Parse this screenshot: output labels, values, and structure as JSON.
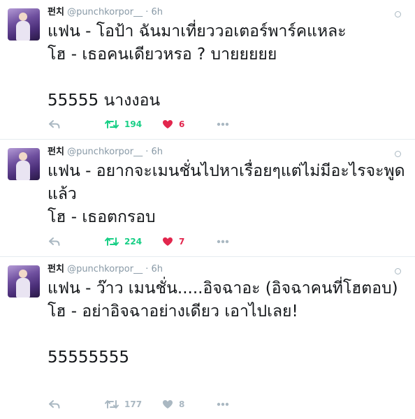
{
  "tweets": [
    {
      "name": "펀치",
      "handle": "@punchkorpor__",
      "sep": "·",
      "time": "6h",
      "text": "แฟน - โอป้า ฉันมาเที่ยววอเตอร์พาร์คแหละ\nโฮ - เธอคนเดียวหรอ ? บายยยยย\n\n55555 นางงอน",
      "retweets": "194",
      "likes": "6",
      "retweeted": true,
      "liked": true
    },
    {
      "name": "펀치",
      "handle": "@punchkorpor__",
      "sep": "·",
      "time": "6h",
      "text": "แฟน - อยากจะเมนชั่นไปหาเรื่อยๆแต่ไม่มีอะไรจะพูดแล้ว\nโฮ - เธอตกรอบ",
      "retweets": "224",
      "likes": "7",
      "retweeted": true,
      "liked": true
    },
    {
      "name": "펀치",
      "handle": "@punchkorpor__",
      "sep": "·",
      "time": "6h",
      "text": "แฟน - ว๊าว เมนชั่น.....อิจฉาอะ (อิจฉาคนที่โฮตอบ)\nโฮ - อย่าอิจฉาอย่างเดียว เอาไปเลย!\n\n55555555",
      "retweets": "177",
      "likes": "8",
      "retweeted": false,
      "liked": false
    }
  ],
  "colors": {
    "retweet_active": "#19cf86",
    "like_active": "#e2264d",
    "action_inactive": "#aab8c2",
    "meta": "#8899a6"
  },
  "icons": [
    "reply-icon",
    "retweet-icon",
    "heart-icon",
    "more-icon",
    "caret-icon"
  ]
}
